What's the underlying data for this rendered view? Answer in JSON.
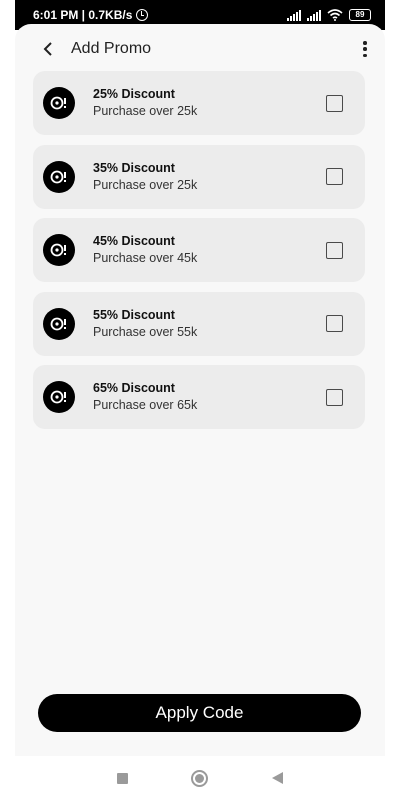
{
  "status_bar": {
    "time_speed": "6:01 PM | 0.7KB/s",
    "battery": "89",
    "icons": [
      "alarm-icon",
      "signal-icon",
      "signal-icon",
      "wifi-icon",
      "battery-icon"
    ]
  },
  "header": {
    "title": "Add Promo",
    "icons": {
      "back": "back-arrow-icon",
      "more": "more-vert-icon"
    }
  },
  "promos": [
    {
      "title": "25% Discount",
      "subtitle": "Purchase over 25k",
      "checked": false
    },
    {
      "title": "35% Discount",
      "subtitle": "Purchase over 25k",
      "checked": false
    },
    {
      "title": "45% Discount",
      "subtitle": "Purchase over 45k",
      "checked": false
    },
    {
      "title": "55% Discount",
      "subtitle": "Purchase over 55k",
      "checked": false
    },
    {
      "title": "65% Discount",
      "subtitle": "Purchase over 65k",
      "checked": false
    }
  ],
  "apply_button": {
    "label": "Apply Code"
  },
  "nav_bar": {
    "icons": [
      "recents-square-icon",
      "home-circle-icon",
      "back-triangle-icon"
    ]
  },
  "colors": {
    "accent": "#000000",
    "card_bg": "#ececec",
    "page_bg": "#f8f8f8"
  }
}
